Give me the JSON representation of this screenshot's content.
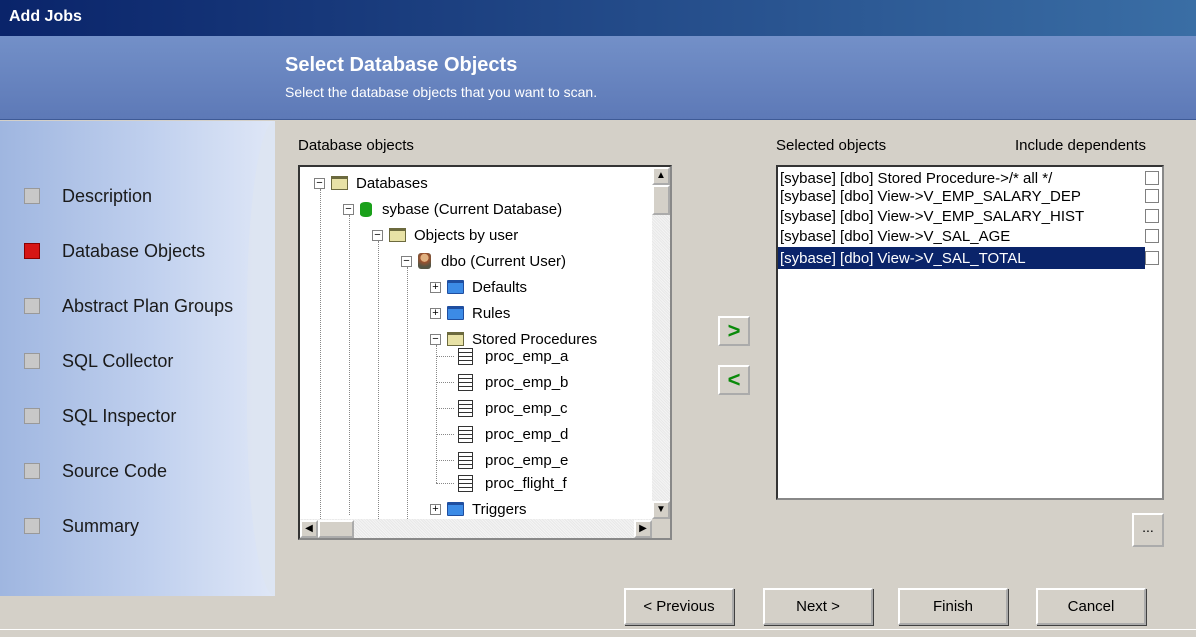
{
  "window": {
    "title": "Add Jobs"
  },
  "header": {
    "title": "Select Database Objects",
    "subtitle": "Select the database objects that you want to scan."
  },
  "steps": [
    {
      "label": "Description",
      "active": false
    },
    {
      "label": "Database Objects",
      "active": true
    },
    {
      "label": "Abstract Plan Groups",
      "active": false
    },
    {
      "label": "SQL Collector",
      "active": false
    },
    {
      "label": "SQL Inspector",
      "active": false
    },
    {
      "label": "Source Code",
      "active": false
    },
    {
      "label": "Summary",
      "active": false
    }
  ],
  "db_objects": {
    "label": "Database objects",
    "tree": [
      {
        "label": "Databases",
        "icon": "folder-open-icon",
        "expander": "−"
      },
      {
        "label": "sybase (Current Database)",
        "icon": "database-icon",
        "expander": "−"
      },
      {
        "label": "Objects by user",
        "icon": "folder-open-icon",
        "expander": "−"
      },
      {
        "label": "dbo (Current User)",
        "icon": "user-icon",
        "expander": "−"
      },
      {
        "label": "Defaults",
        "icon": "folder-icon",
        "expander": "+"
      },
      {
        "label": "Rules",
        "icon": "folder-icon",
        "expander": "+"
      },
      {
        "label": "Stored Procedures",
        "icon": "folder-open-icon",
        "expander": "−"
      },
      {
        "label": "proc_emp_a",
        "icon": "procedure-icon"
      },
      {
        "label": "proc_emp_b",
        "icon": "procedure-icon"
      },
      {
        "label": "proc_emp_c",
        "icon": "procedure-icon"
      },
      {
        "label": "proc_emp_d",
        "icon": "procedure-icon"
      },
      {
        "label": "proc_emp_e",
        "icon": "procedure-icon"
      },
      {
        "label": "proc_flight_f",
        "icon": "procedure-icon"
      },
      {
        "label": "Triggers",
        "icon": "folder-icon",
        "expander": "+"
      }
    ]
  },
  "transfer": {
    "add_glyph": ">",
    "remove_glyph": "<"
  },
  "selected": {
    "label": "Selected objects",
    "dependents_label": "Include dependents",
    "items": [
      {
        "text": "[sybase] [dbo] Stored Procedure->/* all */",
        "selected": false,
        "include_dependents": false
      },
      {
        "text": "[sybase] [dbo] View->V_EMP_SALARY_DEP",
        "selected": false,
        "include_dependents": false
      },
      {
        "text": "[sybase] [dbo] View->V_EMP_SALARY_HIST",
        "selected": false,
        "include_dependents": false
      },
      {
        "text": "[sybase] [dbo] View->V_SAL_AGE",
        "selected": false,
        "include_dependents": false
      },
      {
        "text": "[sybase] [dbo] View->V_SAL_TOTAL",
        "selected": true,
        "include_dependents": false
      }
    ],
    "more_label": "..."
  },
  "buttons": {
    "previous": "< Previous",
    "next": "Next >",
    "finish": "Finish",
    "cancel": "Cancel"
  },
  "colors": {
    "title_bar": "#0a246a",
    "header": "#6a86c2",
    "active_step": "#d61515",
    "selection": "#0a246a"
  }
}
